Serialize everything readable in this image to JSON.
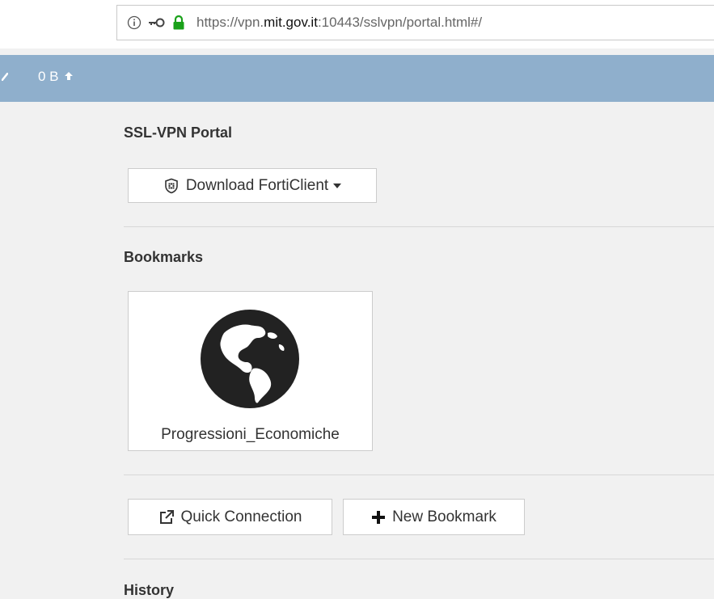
{
  "browser": {
    "url_prefix": "https://vpn.",
    "url_host": "mit.gov.it",
    "url_suffix": ":10443/sslvpn/portal.html#/"
  },
  "topbar": {
    "traffic_value": "0 B"
  },
  "portal": {
    "title": "SSL-VPN Portal",
    "download_label": "Download FortiClient"
  },
  "bookmarks": {
    "title": "Bookmarks",
    "items": [
      {
        "label": "Progressioni_Economiche",
        "icon": "globe-icon"
      }
    ]
  },
  "actions": {
    "quick_connection_label": "Quick Connection",
    "new_bookmark_label": "New Bookmark"
  },
  "history": {
    "title": "History"
  }
}
